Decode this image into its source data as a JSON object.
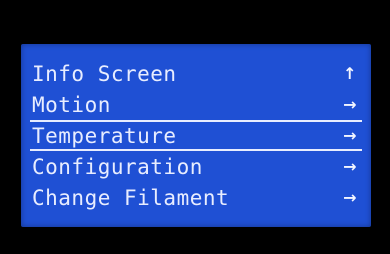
{
  "menu": {
    "items": [
      {
        "label": "Info Screen",
        "icon": "↑",
        "icon_name": "up-arrow-icon"
      },
      {
        "label": "Motion",
        "icon": "→",
        "icon_name": "right-arrow-icon"
      },
      {
        "label": "Temperature",
        "icon": "→",
        "icon_name": "right-arrow-icon",
        "selected": true
      },
      {
        "label": "Configuration",
        "icon": "→",
        "icon_name": "right-arrow-icon"
      },
      {
        "label": "Change Filament",
        "icon": "→",
        "icon_name": "right-arrow-icon"
      }
    ]
  },
  "colors": {
    "screen_background": "#1f50d4",
    "text": "#e8edff",
    "bezel": "#000000"
  }
}
